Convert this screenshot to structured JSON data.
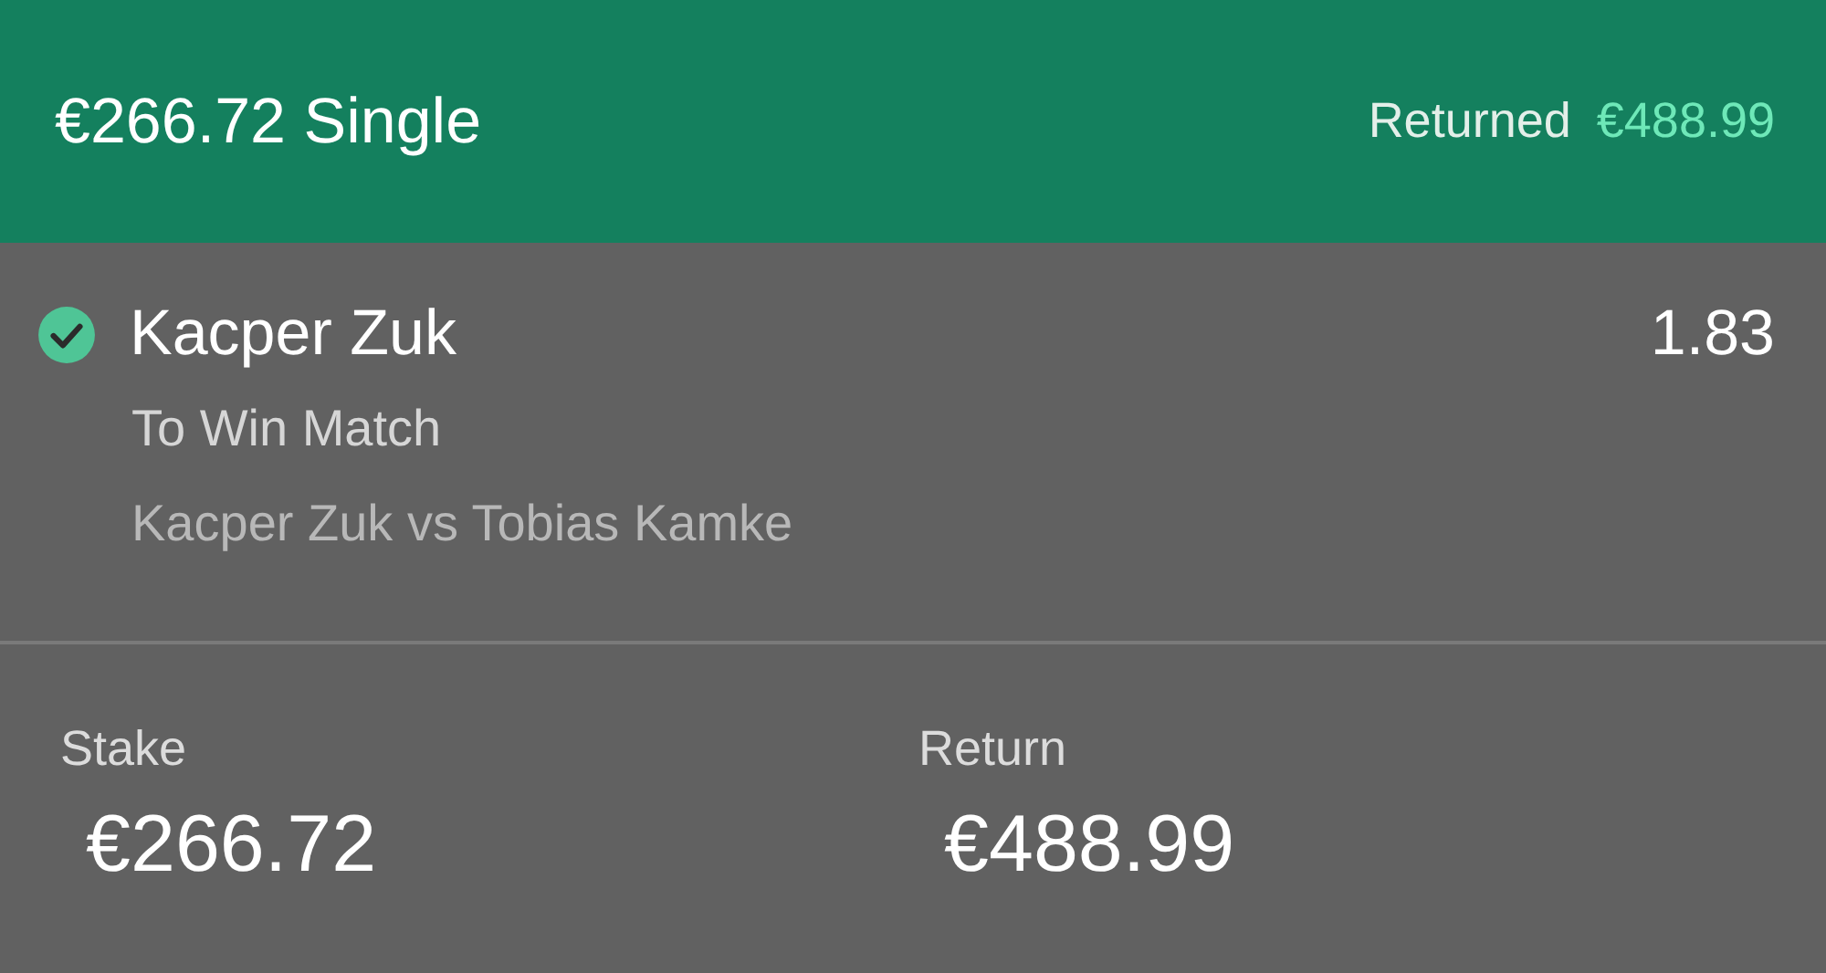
{
  "header": {
    "title": "€266.72 Single",
    "returned_label": "Returned",
    "returned_amount": "€488.99"
  },
  "selection": {
    "won": true,
    "name": "Kacper Zuk",
    "odds": "1.83",
    "market": "To Win Match",
    "event": "Kacper Zuk vs Tobias Kamke"
  },
  "summary": [
    {
      "label": "Stake",
      "value": "€266.72"
    },
    {
      "label": "Return",
      "value": "€488.99"
    }
  ]
}
